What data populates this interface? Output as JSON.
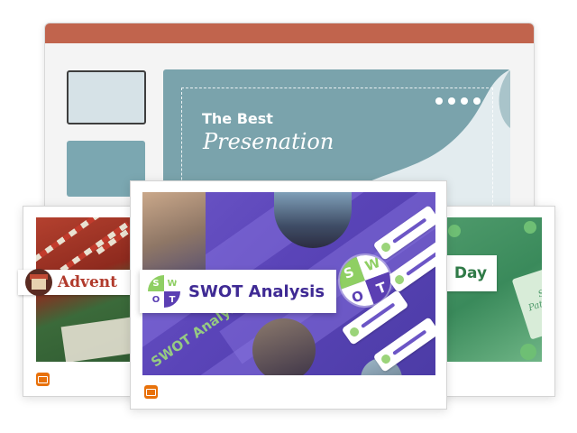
{
  "editor": {
    "slide_title": "The Best",
    "slide_subtitle": "Presenation",
    "colors": {
      "titlebar": "#c1644d",
      "slide_bg": "#7aa3ac",
      "thumbnail_selected": "#d6e2e7"
    }
  },
  "templates": [
    {
      "id": "advent",
      "label": "Advent",
      "format_icon": "presentation-icon"
    },
    {
      "id": "swot",
      "label": "SWOT Analysis",
      "logo_letters": [
        "S",
        "W",
        "O",
        "T"
      ],
      "background_text": "SWOT Analysis",
      "format_icon": "presentation-icon"
    },
    {
      "id": "st-patricks",
      "label": "Day",
      "slide_text": "St. Patrick's Day"
    }
  ],
  "colors": {
    "format_badge": "#e8710a",
    "swot_purple": "#5b3fb3",
    "swot_green": "#8fcf63"
  }
}
